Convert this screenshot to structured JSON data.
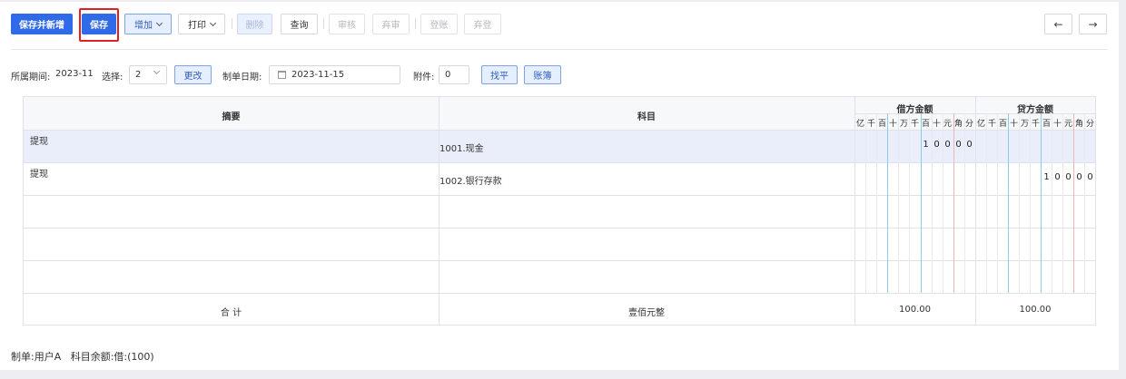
{
  "toolbar": {
    "save_new": "保存并新增",
    "save": "保存",
    "add": "增加",
    "print": "打印",
    "delete": "删除",
    "query": "查询",
    "audit": "审核",
    "unaudit": "弃审",
    "post": "登账",
    "unpost": "弃登",
    "prev_icon": "←",
    "next_icon": "→"
  },
  "form": {
    "period_label": "所属期间:",
    "period_value": "2023-11",
    "select_label": "选择:",
    "select_value": "2",
    "change_button": "更改",
    "date_label": "制单日期:",
    "date_value": "2023-11-15",
    "attach_label": "附件:",
    "attach_value": "0",
    "balance_button": "找平",
    "ledger_button": "账簿"
  },
  "table": {
    "col_summary": "摘要",
    "col_account": "科目",
    "col_debit": "借方金额",
    "col_credit": "贷方金额",
    "digit_labels": [
      "亿",
      "千",
      "百",
      "十",
      "万",
      "千",
      "百",
      "十",
      "元",
      "角",
      "分"
    ],
    "rows": [
      {
        "summary": "提现",
        "account": "1001.现金",
        "debit_digits": [
          "1",
          "0",
          "0",
          "0",
          "0"
        ],
        "credit_digits": []
      },
      {
        "summary": "提现",
        "account": "1002.银行存款",
        "debit_digits": [],
        "credit_digits": [
          "1",
          "0",
          "0",
          "0",
          "0"
        ]
      },
      {
        "summary": "",
        "account": "",
        "debit_digits": [],
        "credit_digits": []
      },
      {
        "summary": "",
        "account": "",
        "debit_digits": [],
        "credit_digits": []
      },
      {
        "summary": "",
        "account": "",
        "debit_digits": [],
        "credit_digits": []
      }
    ],
    "total_label": "合 计",
    "total_words": "壹佰元整",
    "total_debit": "100.00",
    "total_credit": "100.00"
  },
  "footer": {
    "text": "制单:用户A   科目余额:借:(100)"
  },
  "colors": {
    "primary": "#2f6ae8",
    "highlight_row": "#eaeefb",
    "highlight_border": "#e02020",
    "yuan_line": "#8ecbe6",
    "wan_line": "#8ecbe6",
    "jiao_line": "#f0b6b6"
  }
}
